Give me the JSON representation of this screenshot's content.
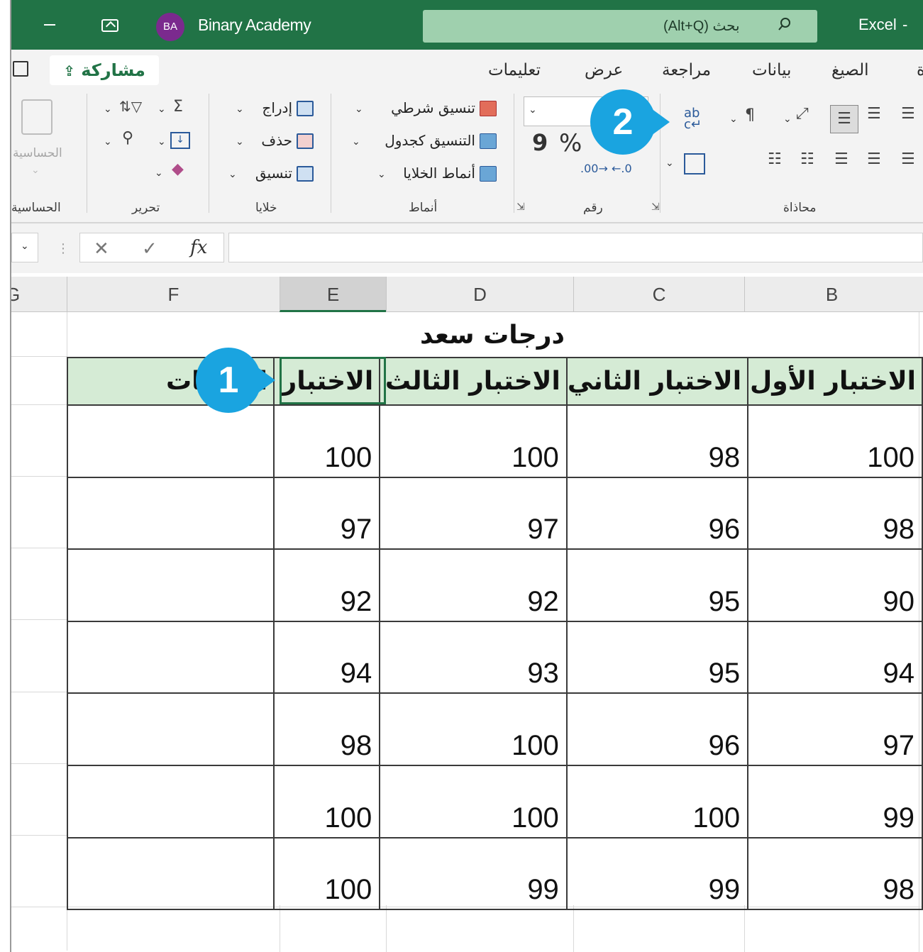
{
  "titlebar": {
    "avatar_initials": "BA",
    "account_name": "Binary Academy",
    "search_placeholder": "بحث (Alt+Q)",
    "app_name": "Excel",
    "app_name_suffix": "-"
  },
  "ribbon": {
    "tabs": [
      "الصيغ",
      "بيانات",
      "مراجعة",
      "عرض",
      "تعليمات"
    ],
    "share_label": "مشاركة",
    "groups": {
      "alignment": "محاذاة",
      "number": "رقم",
      "styles": "أنماط",
      "cells": "خلايا",
      "editing": "تحرير",
      "accounts": "الحساسية"
    },
    "styles_cmds": [
      "تنسيق شرطي",
      "التنسيق كجدول",
      "أنماط الخلايا"
    ],
    "cells_cmds": [
      "إدراج",
      "حذف",
      "تنسيق"
    ],
    "number_symbols": {
      "percent": "%",
      "comma": "9"
    },
    "sensitivity_label": "الحساسية"
  },
  "formula_bar": {
    "cancel_glyph": "✕",
    "enter_glyph": "✓",
    "fx": "fx",
    "value": ""
  },
  "grid": {
    "columns": [
      "F",
      "E",
      "D",
      "C",
      "B"
    ],
    "edge_col": "G",
    "title": "درجات سعد",
    "headers": [
      "الدرجات",
      "الاختبار",
      "الاختبار الثالث",
      "الاختبار الثاني",
      "الاختبار الأول"
    ],
    "rows": [
      [
        "",
        "100",
        "100",
        "98",
        "100"
      ],
      [
        "",
        "97",
        "97",
        "96",
        "98"
      ],
      [
        "",
        "92",
        "92",
        "95",
        "90"
      ],
      [
        "",
        "94",
        "93",
        "95",
        "94"
      ],
      [
        "",
        "98",
        "100",
        "96",
        "97"
      ],
      [
        "",
        "100",
        "100",
        "100",
        "99"
      ],
      [
        "",
        "100",
        "99",
        "99",
        "98"
      ]
    ]
  },
  "callouts": {
    "one": "1",
    "two": "2"
  },
  "colors": {
    "excel_green": "#217346",
    "header_fill": "#d5ebd5",
    "callout_blue": "#1aa4e0"
  }
}
